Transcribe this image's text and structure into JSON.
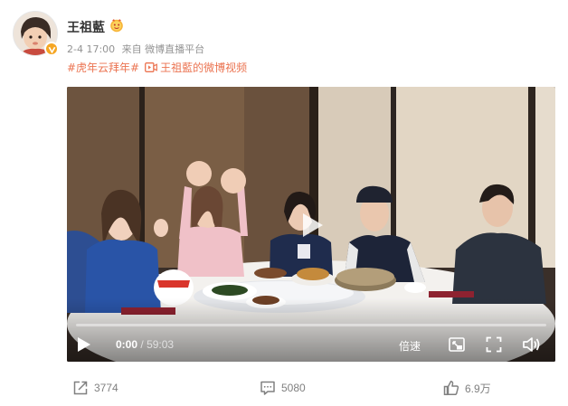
{
  "post": {
    "author": {
      "name": "王祖藍",
      "verified": true
    },
    "meta": {
      "time": "2-4 17:00",
      "source": "来自 微博直播平台"
    },
    "text": {
      "topic": "#虎年云拜年#",
      "video_link": "王祖藍的微博视频"
    },
    "video": {
      "current_time": "0:00",
      "separator": "/",
      "duration": "59:03",
      "progress": 0,
      "speed_label": "倍速"
    },
    "stats": {
      "reposts": "3774",
      "comments": "5080",
      "likes": "6.9万"
    }
  },
  "colors": {
    "link": "#eb7350",
    "meta": "#939393",
    "badge": "#f5a623"
  },
  "icons": [
    "verified-badge-icon",
    "medal-icon",
    "video-link-icon",
    "play-icon",
    "pip-icon",
    "fullscreen-icon",
    "volume-icon",
    "share-icon",
    "comment-icon",
    "like-icon"
  ]
}
